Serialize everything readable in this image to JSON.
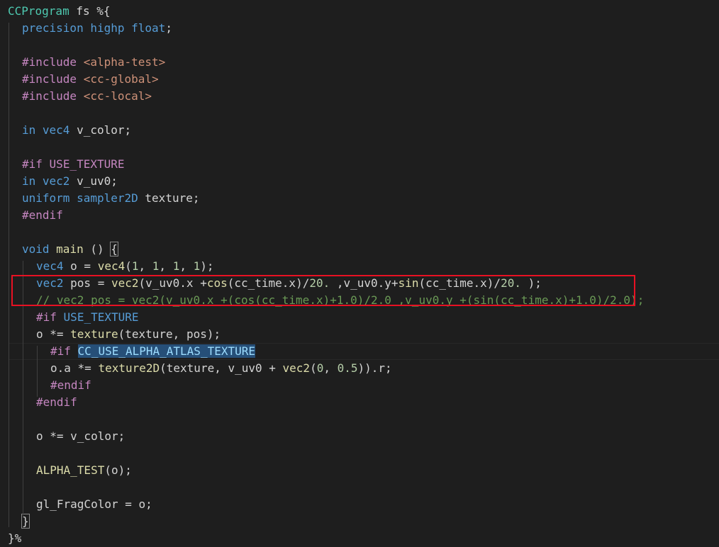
{
  "editor": {
    "lines": [
      {
        "indent": 0,
        "tokens": [
          [
            "teal",
            "CCProgram"
          ],
          [
            "plain",
            " fs %{"
          ]
        ]
      },
      {
        "indent": 1,
        "tokens": [
          [
            "kw",
            "precision"
          ],
          [
            "plain",
            " "
          ],
          [
            "kw",
            "highp"
          ],
          [
            "plain",
            " "
          ],
          [
            "kw",
            "float"
          ],
          [
            "plain",
            ";"
          ]
        ]
      },
      {
        "indent": 0,
        "tokens": []
      },
      {
        "indent": 1,
        "tokens": [
          [
            "pp",
            "#include"
          ],
          [
            "plain",
            " "
          ],
          [
            "str",
            "<alpha-test>"
          ]
        ]
      },
      {
        "indent": 1,
        "tokens": [
          [
            "pp",
            "#include"
          ],
          [
            "plain",
            " "
          ],
          [
            "str",
            "<cc-global>"
          ]
        ]
      },
      {
        "indent": 1,
        "tokens": [
          [
            "pp",
            "#include"
          ],
          [
            "plain",
            " "
          ],
          [
            "str",
            "<cc-local>"
          ]
        ]
      },
      {
        "indent": 0,
        "tokens": []
      },
      {
        "indent": 1,
        "tokens": [
          [
            "kw",
            "in"
          ],
          [
            "plain",
            " "
          ],
          [
            "kw",
            "vec4"
          ],
          [
            "plain",
            " v_color;"
          ]
        ]
      },
      {
        "indent": 0,
        "tokens": []
      },
      {
        "indent": 1,
        "tokens": [
          [
            "pp",
            "#if"
          ],
          [
            "plain",
            " "
          ],
          [
            "pp",
            "USE_TEXTURE"
          ]
        ]
      },
      {
        "indent": 1,
        "tokens": [
          [
            "kw",
            "in"
          ],
          [
            "plain",
            " "
          ],
          [
            "kw",
            "vec2"
          ],
          [
            "plain",
            " v_uv0;"
          ]
        ]
      },
      {
        "indent": 1,
        "tokens": [
          [
            "kw",
            "uniform"
          ],
          [
            "plain",
            " "
          ],
          [
            "kw",
            "sampler2D"
          ],
          [
            "plain",
            " texture;"
          ]
        ]
      },
      {
        "indent": 1,
        "tokens": [
          [
            "pp",
            "#endif"
          ]
        ]
      },
      {
        "indent": 0,
        "tokens": []
      },
      {
        "indent": 1,
        "tokens": [
          [
            "kw",
            "void"
          ],
          [
            "plain",
            " "
          ],
          [
            "fn",
            "main"
          ],
          [
            "plain",
            " () "
          ],
          [
            "match",
            "{"
          ]
        ]
      },
      {
        "indent": 2,
        "tokens": [
          [
            "kw",
            "vec4"
          ],
          [
            "plain",
            " o = "
          ],
          [
            "fn",
            "vec4"
          ],
          [
            "plain",
            "("
          ],
          [
            "num",
            "1"
          ],
          [
            "plain",
            ", "
          ],
          [
            "num",
            "1"
          ],
          [
            "plain",
            ", "
          ],
          [
            "num",
            "1"
          ],
          [
            "plain",
            ", "
          ],
          [
            "num",
            "1"
          ],
          [
            "plain",
            ");"
          ]
        ]
      },
      {
        "indent": 2,
        "tokens": [
          [
            "kw",
            "vec2"
          ],
          [
            "plain",
            " pos = "
          ],
          [
            "fn",
            "vec2"
          ],
          [
            "plain",
            "(v_uv0.x +"
          ],
          [
            "fn",
            "cos"
          ],
          [
            "plain",
            "(cc_time.x)/"
          ],
          [
            "num",
            "20."
          ],
          [
            "plain",
            " ,v_uv0.y+"
          ],
          [
            "fn",
            "sin"
          ],
          [
            "plain",
            "(cc_time.x)/"
          ],
          [
            "num",
            "20."
          ],
          [
            "plain",
            " );"
          ]
        ]
      },
      {
        "indent": 2,
        "tokens": [
          [
            "cm",
            "// vec2 pos = vec2(v_uv0.x +(cos(cc_time.x)+1.0)/2.0 ,v_uv0.y +(sin(cc_time.x)+1.0)/2.0);"
          ]
        ]
      },
      {
        "indent": 2,
        "tokens": [
          [
            "pp",
            "#if"
          ],
          [
            "plain",
            " "
          ],
          [
            "kw",
            "USE_TEXTURE"
          ]
        ]
      },
      {
        "indent": 2,
        "tokens": [
          [
            "plain",
            "o *= "
          ],
          [
            "fn",
            "texture"
          ],
          [
            "plain",
            "(texture, pos);"
          ]
        ]
      },
      {
        "indent": 3,
        "tokens": [
          [
            "pp",
            "#if"
          ],
          [
            "plain",
            " "
          ],
          [
            "sel",
            "CC_USE_ALPHA_ATLAS_TEXTURE"
          ]
        ]
      },
      {
        "indent": 3,
        "tokens": [
          [
            "plain",
            "o.a *= "
          ],
          [
            "fn",
            "texture2D"
          ],
          [
            "plain",
            "(texture, v_uv0 + "
          ],
          [
            "fn",
            "vec2"
          ],
          [
            "plain",
            "("
          ],
          [
            "num",
            "0"
          ],
          [
            "plain",
            ", "
          ],
          [
            "num",
            "0.5"
          ],
          [
            "plain",
            ")).r;"
          ]
        ]
      },
      {
        "indent": 3,
        "tokens": [
          [
            "pp",
            "#endif"
          ]
        ]
      },
      {
        "indent": 2,
        "tokens": [
          [
            "pp",
            "#endif"
          ]
        ]
      },
      {
        "indent": 0,
        "tokens": []
      },
      {
        "indent": 2,
        "tokens": [
          [
            "plain",
            "o *= v_color;"
          ]
        ]
      },
      {
        "indent": 0,
        "tokens": []
      },
      {
        "indent": 2,
        "tokens": [
          [
            "fn",
            "ALPHA_TEST"
          ],
          [
            "plain",
            "(o);"
          ]
        ]
      },
      {
        "indent": 0,
        "tokens": []
      },
      {
        "indent": 2,
        "tokens": [
          [
            "plain",
            "gl_FragColor = o;"
          ]
        ]
      },
      {
        "indent": 1,
        "tokens": [
          [
            "match",
            "}"
          ]
        ]
      },
      {
        "indent": 0,
        "tokens": [
          [
            "plain",
            "}%"
          ]
        ]
      }
    ]
  }
}
